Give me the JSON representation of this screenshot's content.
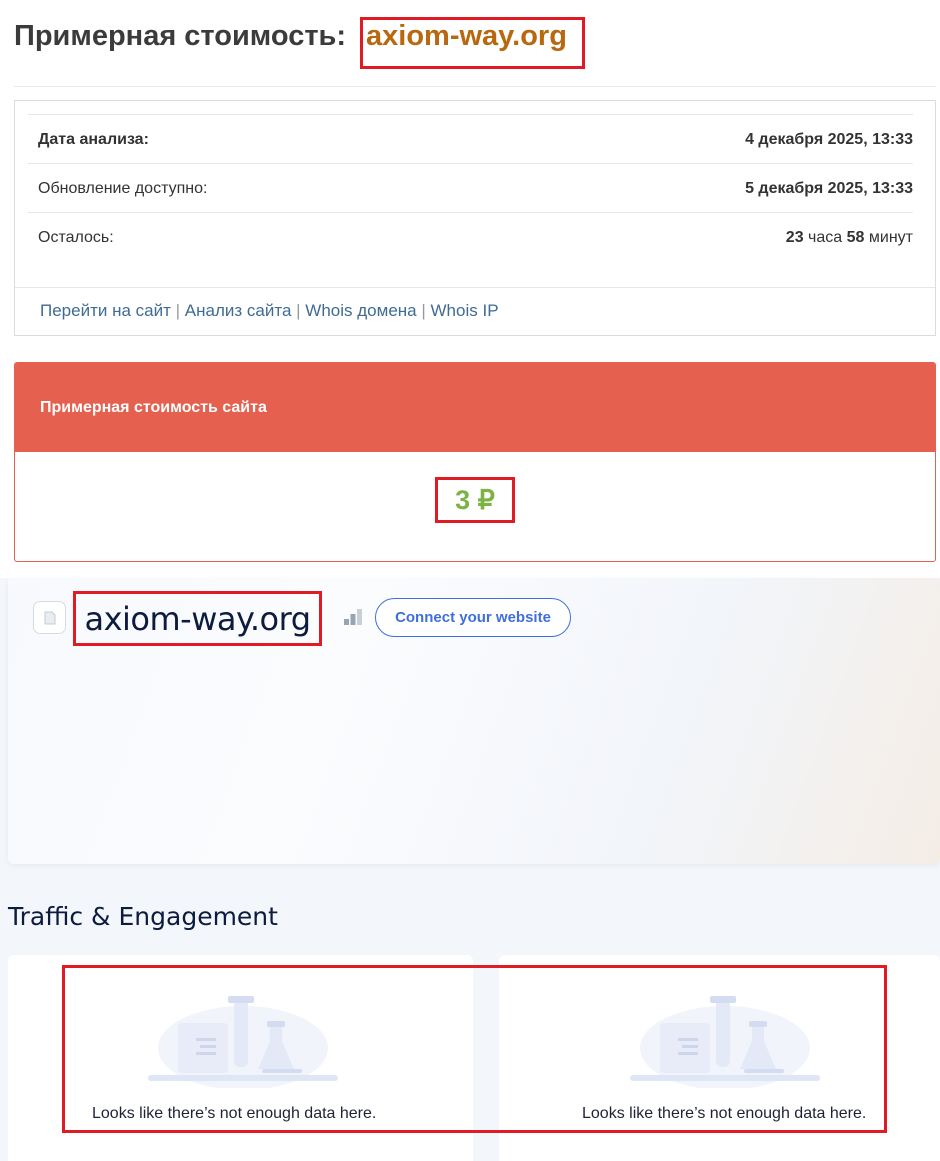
{
  "header": {
    "title_prefix": "Примерная стоимость:",
    "domain": "axiom-way.org"
  },
  "info": {
    "rows": [
      {
        "label": "Дата анализа:",
        "value": "4 декабря 2025, 13:33"
      },
      {
        "label": "Обновление доступно:",
        "value": "5 декабря 2025, 13:33"
      }
    ],
    "remaining_label": "Осталось:",
    "remaining": {
      "hours": "23",
      "hours_unit": "часа",
      "minutes": "58",
      "minutes_unit": "минут"
    },
    "links": [
      "Перейти на сайт",
      "Анализ сайта",
      "Whois домена",
      "Whois IP"
    ],
    "link_separator": "|"
  },
  "cost": {
    "title": "Примерная стоимость сайта",
    "value": "3 ₽"
  },
  "similarweb": {
    "domain": "axiom-way.org",
    "favicon_icon": "page-icon",
    "rank_icon": "bar-chart-icon",
    "connect_button": "Connect your website",
    "section_title": "Traffic & Engagement",
    "empty_left": "Looks like there’s not enough data here.",
    "empty_right": "Looks like there’s not enough data here."
  },
  "colors": {
    "domain_title": "#b8690f",
    "cost_header": "#e5604f",
    "cost_value": "#7cb342",
    "highlight": "#e01b24",
    "link": "#3f6b94",
    "connect_accent": "#3f6fdc"
  }
}
